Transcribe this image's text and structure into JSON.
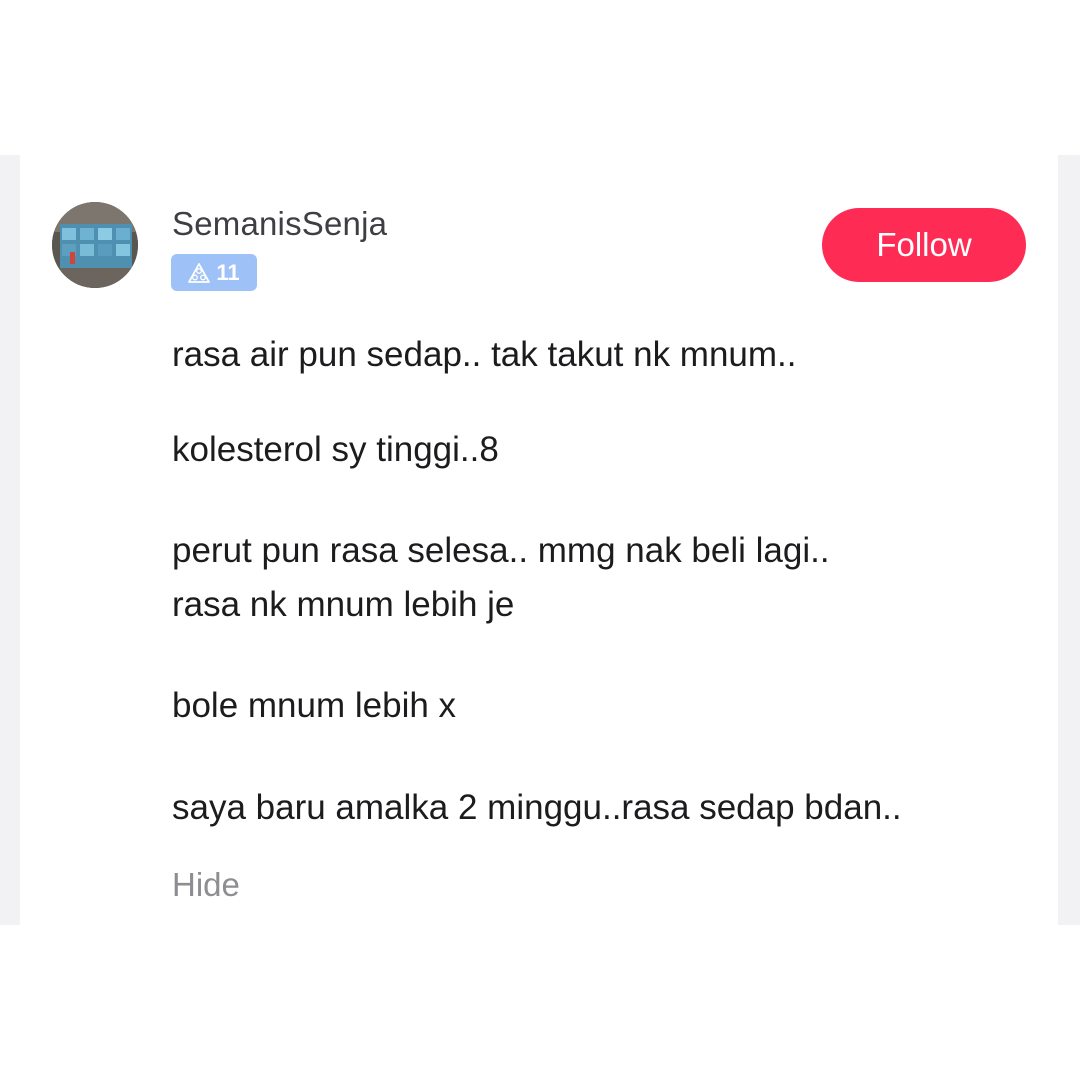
{
  "comment": {
    "username": "SemanisSenja",
    "level_badge": "11",
    "follow_label": "Follow",
    "lines": [
      "rasa air pun sedap.. tak takut nk mnum..",
      "kolesterol sy tinggi..8",
      "perut pun rasa selesa.. mmg nak beli lagi..",
      "rasa nk mnum lebih je",
      "bole mnum lebih x",
      "saya baru amalka 2 minggu..rasa sedap bdan.."
    ],
    "hide_label": "Hide"
  },
  "icons": {
    "level": "level-triangle-icon"
  },
  "colors": {
    "follow_button": "#fe2c55",
    "level_badge": "#9ec1f7",
    "username": "#3e3e44",
    "body_text": "#1c1c1e",
    "hide_text": "#8d8d92"
  }
}
